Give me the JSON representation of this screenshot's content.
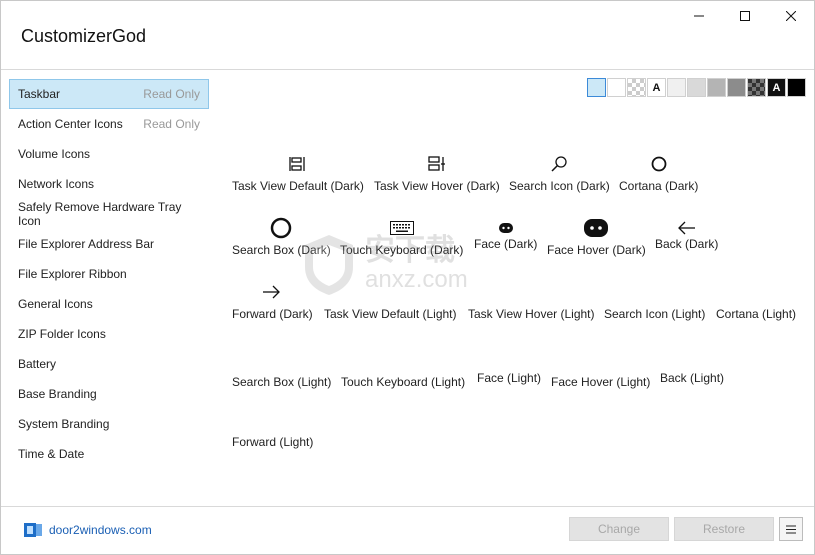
{
  "app": {
    "title": "CustomizerGod"
  },
  "sidebar": {
    "items": [
      {
        "label": "Taskbar",
        "badge": "Read Only",
        "selected": true
      },
      {
        "label": "Action Center Icons",
        "badge": "Read Only"
      },
      {
        "label": "Volume Icons"
      },
      {
        "label": "Network Icons"
      },
      {
        "label": "Safely Remove Hardware Tray Icon"
      },
      {
        "label": "File Explorer Address Bar"
      },
      {
        "label": "File Explorer Ribbon"
      },
      {
        "label": "General Icons"
      },
      {
        "label": "ZIP Folder Icons"
      },
      {
        "label": "Battery"
      },
      {
        "label": "Base Branding"
      },
      {
        "label": "System Branding"
      },
      {
        "label": "Time & Date"
      }
    ]
  },
  "swatches": {
    "items": [
      {
        "name": "light-blue",
        "color": "#cce8f7",
        "selected": true
      },
      {
        "name": "white",
        "color": "#ffffff"
      },
      {
        "name": "checker",
        "color": "checker"
      },
      {
        "name": "white-letter",
        "color": "#ffffff",
        "letter": "A"
      },
      {
        "name": "light-gray-1",
        "color": "#f0f0f0"
      },
      {
        "name": "light-gray-2",
        "color": "#d9d9d9"
      },
      {
        "name": "gray-1",
        "color": "#b4b4b4"
      },
      {
        "name": "gray-2",
        "color": "#8c8c8c"
      },
      {
        "name": "dark-checker",
        "color": "darkchecker"
      },
      {
        "name": "black-letter",
        "color": "#111111",
        "letter": "A"
      },
      {
        "name": "black",
        "color": "#000000"
      }
    ]
  },
  "icons": {
    "items": [
      {
        "label": "Task View Default (Dark)",
        "icon": "task-view-icon"
      },
      {
        "label": "Task View Hover (Dark)",
        "icon": "task-view-hover-icon"
      },
      {
        "label": "Search Icon (Dark)",
        "icon": "search-icon"
      },
      {
        "label": "Cortana (Dark)",
        "icon": "cortana-icon"
      },
      {
        "label": "Search Box (Dark)",
        "icon": "search-box-icon"
      },
      {
        "label": "Touch Keyboard (Dark)",
        "icon": "keyboard-icon"
      },
      {
        "label": "Face (Dark)",
        "icon": "face-icon"
      },
      {
        "label": "Face Hover (Dark)",
        "icon": "face-hover-icon"
      },
      {
        "label": "Back (Dark)",
        "icon": "back-arrow-icon"
      },
      {
        "label": "Forward (Dark)",
        "icon": "forward-arrow-icon"
      },
      {
        "label": "Task View Default (Light)",
        "icon": ""
      },
      {
        "label": "Task View Hover (Light)",
        "icon": ""
      },
      {
        "label": "Search Icon (Light)",
        "icon": ""
      },
      {
        "label": "Cortana (Light)",
        "icon": ""
      },
      {
        "label": "Search Box (Light)",
        "icon": ""
      },
      {
        "label": "Touch Keyboard (Light)",
        "icon": ""
      },
      {
        "label": "Face (Light)",
        "icon": ""
      },
      {
        "label": "Face Hover (Light)",
        "icon": ""
      },
      {
        "label": "Back (Light)",
        "icon": ""
      },
      {
        "label": "Forward (Light)",
        "icon": ""
      }
    ]
  },
  "watermark": {
    "main": "安下载",
    "sub": "anxz.com"
  },
  "footer": {
    "brand": "door2windows.com",
    "change_label": "Change",
    "restore_label": "Restore"
  }
}
